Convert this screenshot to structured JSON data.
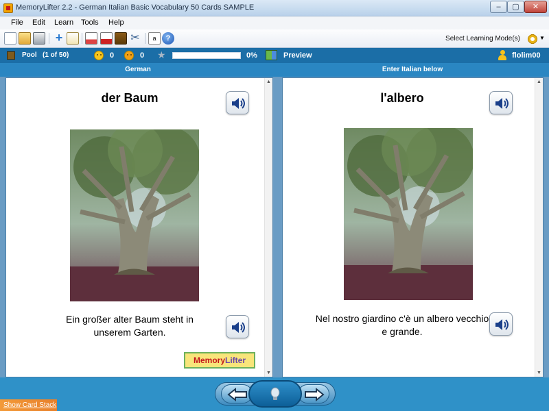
{
  "window": {
    "title": "MemoryLifter 2.2 - German Italian Basic Vocabulary 50 Cards SAMPLE",
    "min": "–",
    "max": "▢",
    "close": "✕"
  },
  "menu": [
    "File",
    "Edit",
    "Learn",
    "Tools",
    "Help"
  ],
  "toolbar": {
    "icons": [
      "new-icon",
      "open-icon",
      "print-icon",
      "add-card-icon",
      "edit-icon",
      "slideshow-icon",
      "statistics-icon",
      "dictionary-icon",
      "settings-icon",
      "character-map-icon",
      "help-icon"
    ],
    "mode_label": "Select Learning Mode(s)"
  },
  "status": {
    "pool_label": "Pool",
    "pool_position": "(1 of 50)",
    "correct_count": "0",
    "wrong_count": "0",
    "progress_percent": 0,
    "progress_label": "0%",
    "preview_label": "Preview",
    "user": "flolim00"
  },
  "columns": {
    "left_header": "German",
    "right_header": "Enter Italian below"
  },
  "question": {
    "word": "der Baum",
    "sentence": "Ein großer alter Baum steht in unserem Garten."
  },
  "answer": {
    "word": "l'albero",
    "sentence": "Nel nostro giardino c'è un albero vecchio e grande."
  },
  "logo": {
    "part_a": "Memory",
    "part_b": "Lifter"
  },
  "bottom": {
    "show_stack": "Show Card Stack"
  },
  "colors": {
    "status_bar": "#1b6ea7",
    "header_bar": "#2a86c2",
    "bottom_bar": "#2f91c8",
    "stack_tab": "#f39a38"
  }
}
